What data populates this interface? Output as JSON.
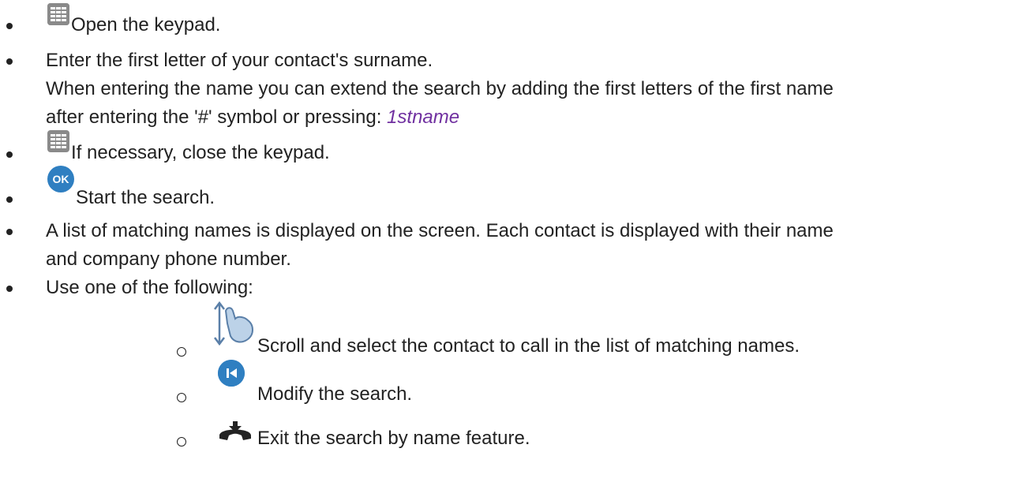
{
  "items": [
    {
      "text": "Open the keypad.",
      "icon": "keypad-icon"
    },
    {
      "text": "Enter the first letter of your contact's surname."
    },
    {
      "text": "When entering the name you can extend the search by adding the first letters of the first name"
    },
    {
      "text": "after entering the '#' symbol or pressing: ",
      "softkey": "1stname"
    },
    {
      "text": "If necessary, close the keypad.",
      "icon": "keypad-icon"
    },
    {
      "text": "Start the search.",
      "icon": "ok-icon",
      "icon_label": "OK"
    },
    {
      "text": "A list of matching names is displayed on the screen. Each contact is displayed with their name"
    },
    {
      "text": "and company phone number."
    },
    {
      "text": "Use one of the following:"
    }
  ],
  "subitems": [
    {
      "text": "Scroll and select the contact to call in the list of matching names.",
      "icon": "scroll-gesture-icon"
    },
    {
      "text": "Modify the search.",
      "icon": "back-to-start-icon"
    },
    {
      "text": "Exit the search by name feature.",
      "icon": "hang-up-icon"
    }
  ],
  "colors": {
    "text": "#222222",
    "softkey": "#7030a0",
    "icon_blue": "#2f7fc1",
    "icon_gray": "#8a8a8a"
  }
}
